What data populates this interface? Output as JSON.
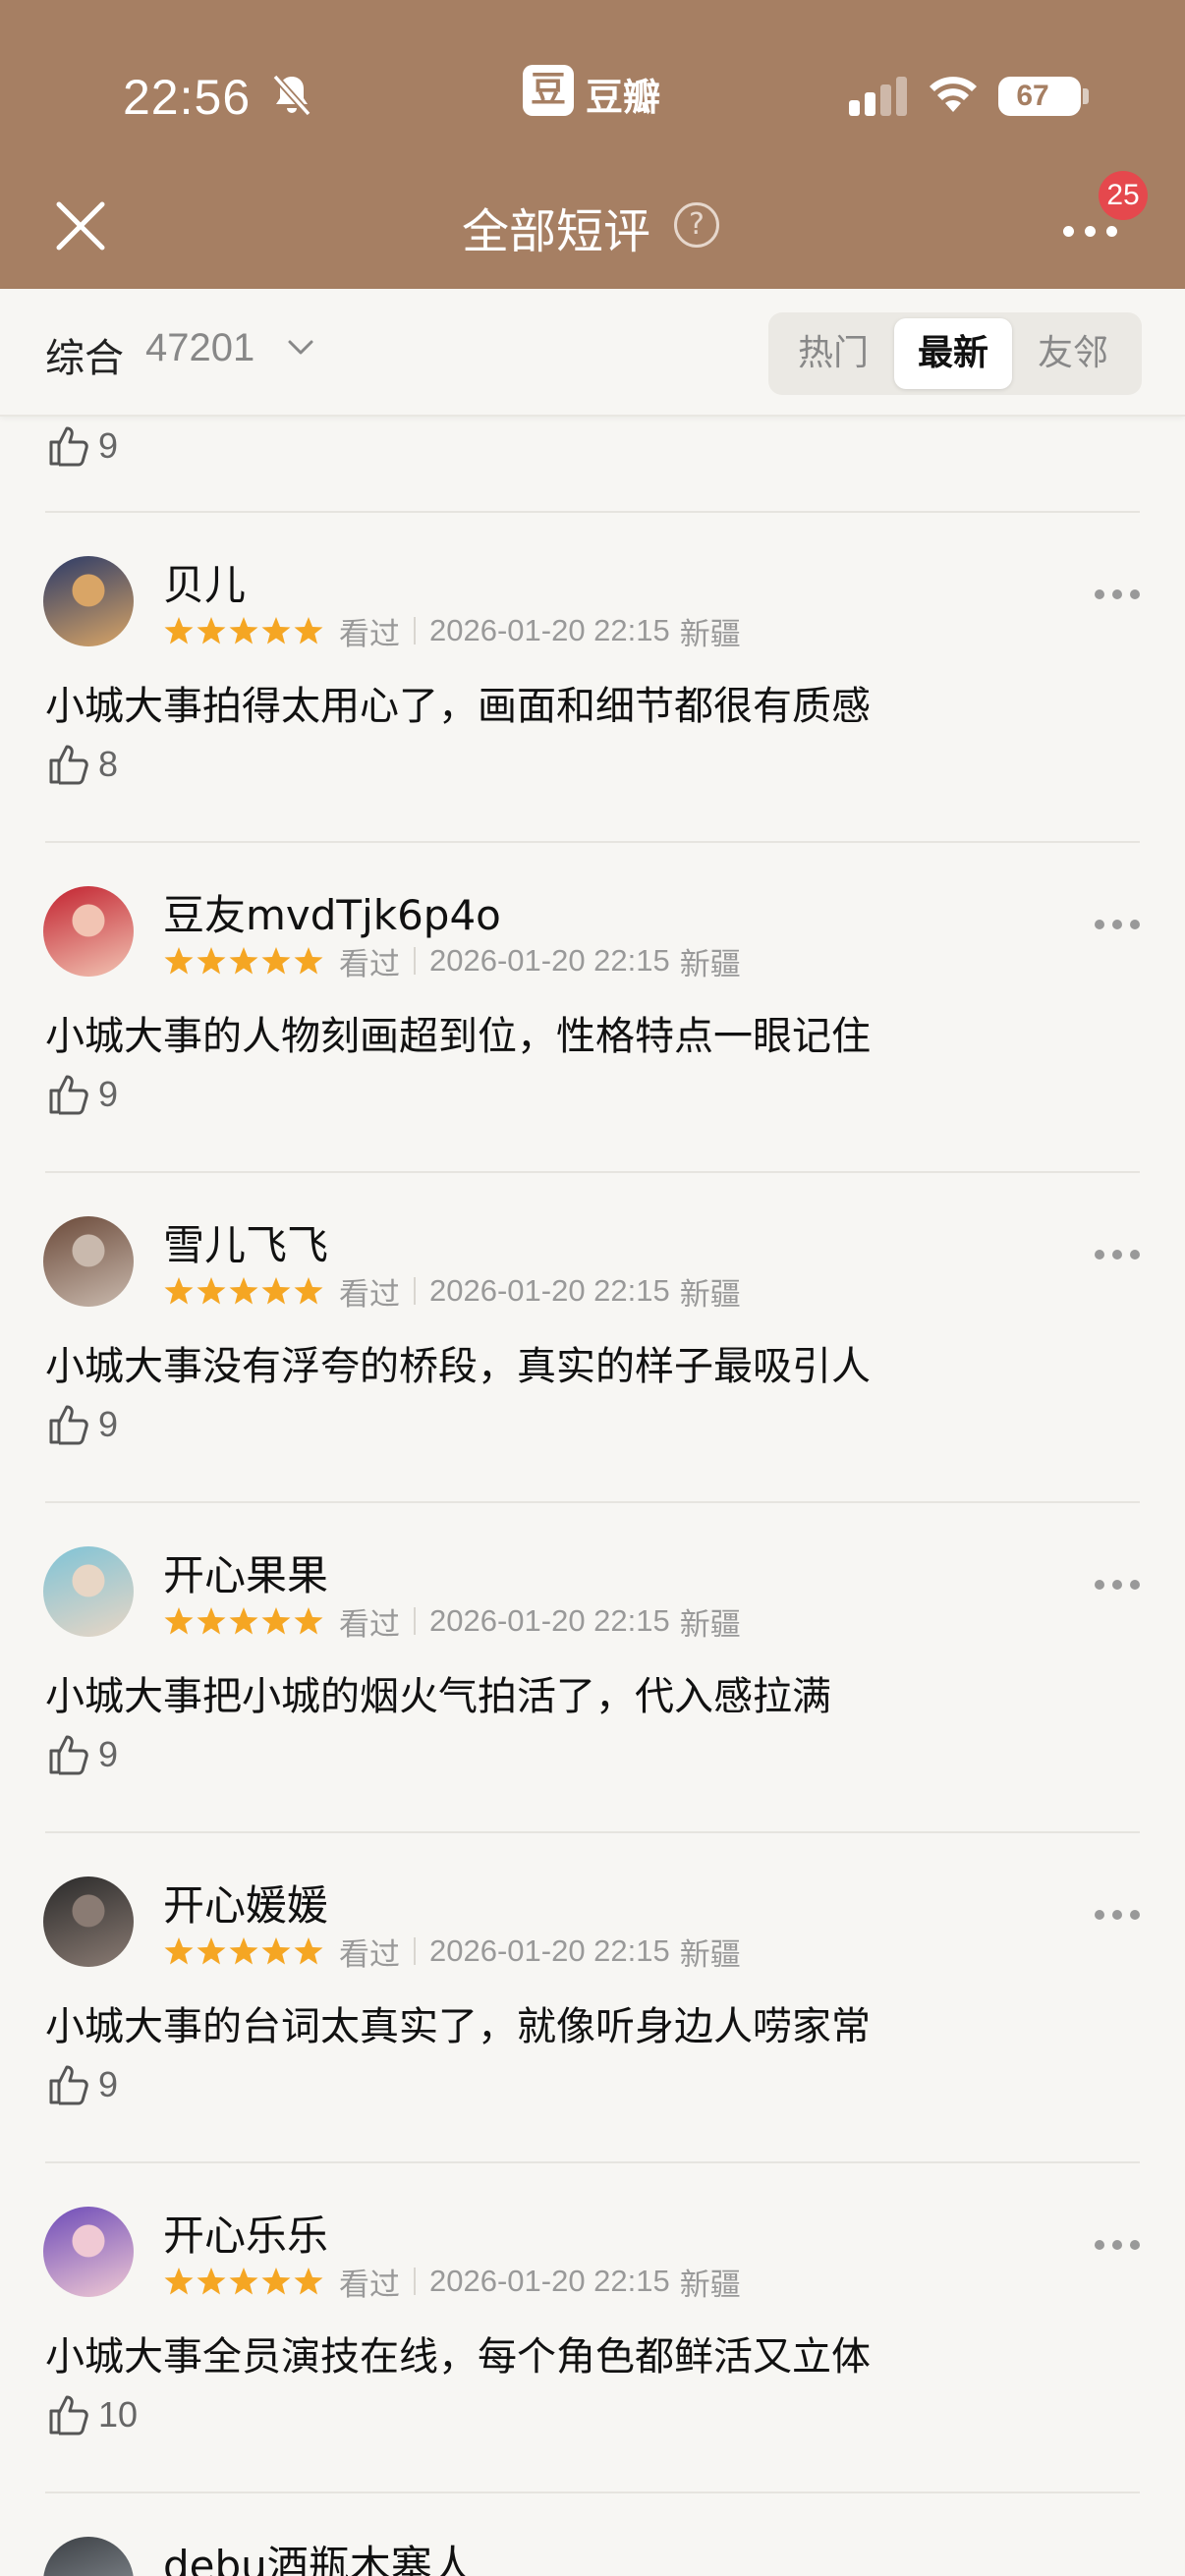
{
  "status_bar": {
    "time": "22:56",
    "app_logo_glyph": "豆",
    "app_name": "豆瓣",
    "battery": "67",
    "icons": [
      "bell-off-icon",
      "signal-icon",
      "wifi-icon",
      "battery-icon"
    ]
  },
  "nav": {
    "title": "全部短评",
    "help_glyph": "?",
    "badge_count": "25",
    "icons": [
      "close-icon",
      "help-icon",
      "more-icon"
    ]
  },
  "filter": {
    "sort_label": "综合",
    "count": "47201",
    "tabs": [
      {
        "label": "热门",
        "active": false
      },
      {
        "label": "最新",
        "active": true
      },
      {
        "label": "友邻",
        "active": false
      }
    ]
  },
  "top_partial": {
    "likes": "9"
  },
  "reviews": [
    {
      "user": "贝儿",
      "rating": 5,
      "status": "看过",
      "date": "2026-01-20 22:15",
      "location": "新疆",
      "text": "小城大事拍得太用心了，画面和细节都很有质感",
      "likes": "8"
    },
    {
      "user": "豆友mvdTjk6p4o",
      "rating": 5,
      "status": "看过",
      "date": "2026-01-20 22:15",
      "location": "新疆",
      "text": "小城大事的人物刻画超到位，性格特点一眼记住",
      "likes": "9"
    },
    {
      "user": "雪儿飞飞",
      "rating": 5,
      "status": "看过",
      "date": "2026-01-20 22:15",
      "location": "新疆",
      "text": "小城大事没有浮夸的桥段，真实的样子最吸引人",
      "likes": "9"
    },
    {
      "user": "开心果果",
      "rating": 5,
      "status": "看过",
      "date": "2026-01-20 22:15",
      "location": "新疆",
      "text": "小城大事把小城的烟火气拍活了，代入感拉满",
      "likes": "9"
    },
    {
      "user": "开心媛媛",
      "rating": 5,
      "status": "看过",
      "date": "2026-01-20 22:15",
      "location": "新疆",
      "text": "小城大事的台词太真实了，就像听身边人唠家常",
      "likes": "9"
    },
    {
      "user": "开心乐乐",
      "rating": 5,
      "status": "看过",
      "date": "2026-01-20 22:15",
      "location": "新疆",
      "text": "小城大事全员演技在线，每个角色都鲜活又立体",
      "likes": "10"
    }
  ],
  "bottom_partial": {
    "user": "debu酒瓶木塞人"
  },
  "colors": {
    "header_bg": "#a67f63",
    "star": "#f5a623",
    "badge": "#e5484d",
    "page_bg": "#f7f6f3"
  }
}
